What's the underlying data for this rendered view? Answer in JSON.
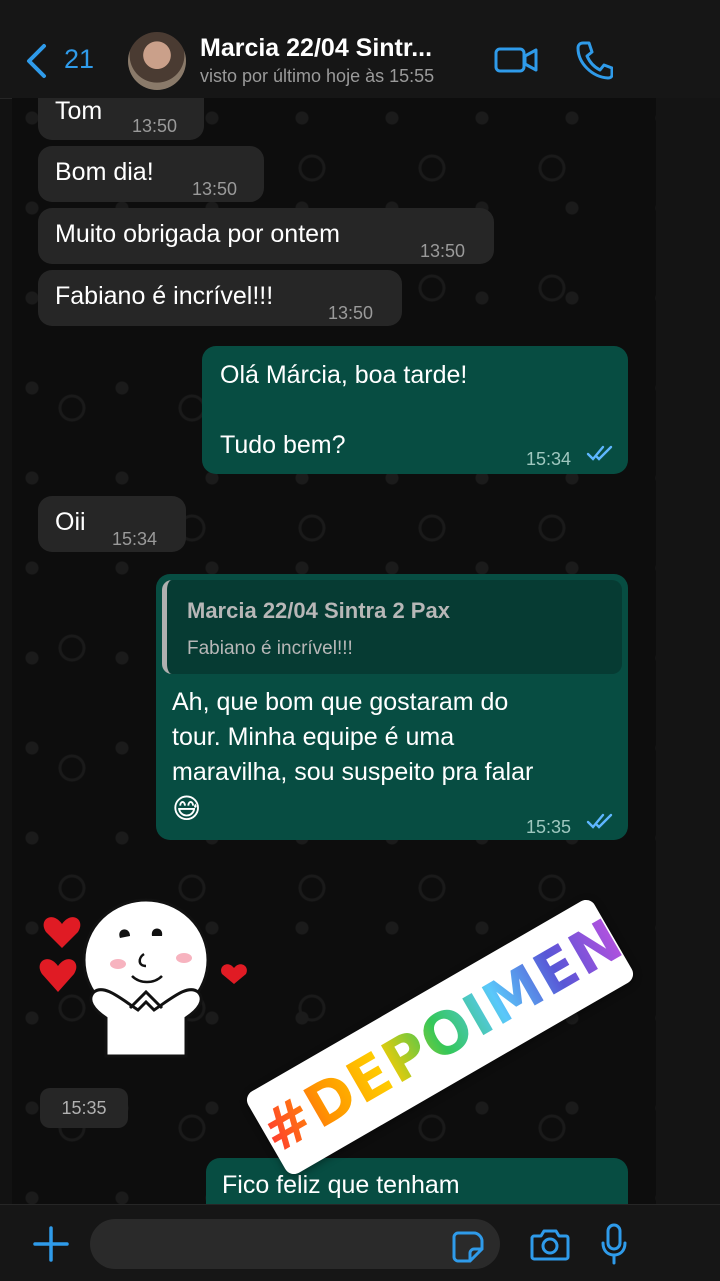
{
  "header": {
    "back_count": "21",
    "contact_name": "Marcia 22/04 Sintr...",
    "status": "visto por último hoje às 15:55"
  },
  "messages": [
    {
      "dir": "in",
      "text": "Tom",
      "time": "13:50"
    },
    {
      "dir": "in",
      "text": "Bom dia!",
      "time": "13:50"
    },
    {
      "dir": "in",
      "text": "Muito obrigada por ontem",
      "time": "13:50"
    },
    {
      "dir": "in",
      "text": "Fabiano é incrível!!!",
      "time": "13:50"
    },
    {
      "dir": "out",
      "line1": "Olá Márcia, boa tarde!",
      "line2": "Tudo bem?",
      "time": "15:34",
      "read": true
    },
    {
      "dir": "in",
      "text": "Oii",
      "time": "15:34"
    },
    {
      "dir": "out",
      "quote_name": "Marcia 22/04 Sintra 2 Pax",
      "quote_text": "Fabiano é incrível!!!",
      "line1": "Ah, que bom que gostaram do",
      "line2": "tour. Minha equipe é uma",
      "line3": "maravilha, sou suspeito pra falar",
      "emoji": "😅",
      "time": "15:35",
      "read": true
    },
    {
      "dir": "in",
      "type": "sticker",
      "time": "15:35"
    },
    {
      "dir": "out",
      "text": "Fico feliz que tenham"
    }
  ],
  "overlay": {
    "hashtag": "#DEPOIMENTOS"
  },
  "icons": [
    "chevron-left-icon",
    "video-call-icon",
    "phone-icon",
    "plus-icon",
    "sticker-icon",
    "camera-icon",
    "microphone-icon",
    "double-check-icon"
  ],
  "colors": {
    "accent": "#2f9bea",
    "outgoing": "#074d42",
    "incoming": "#262626",
    "read_ticks": "#5eb6ff"
  }
}
